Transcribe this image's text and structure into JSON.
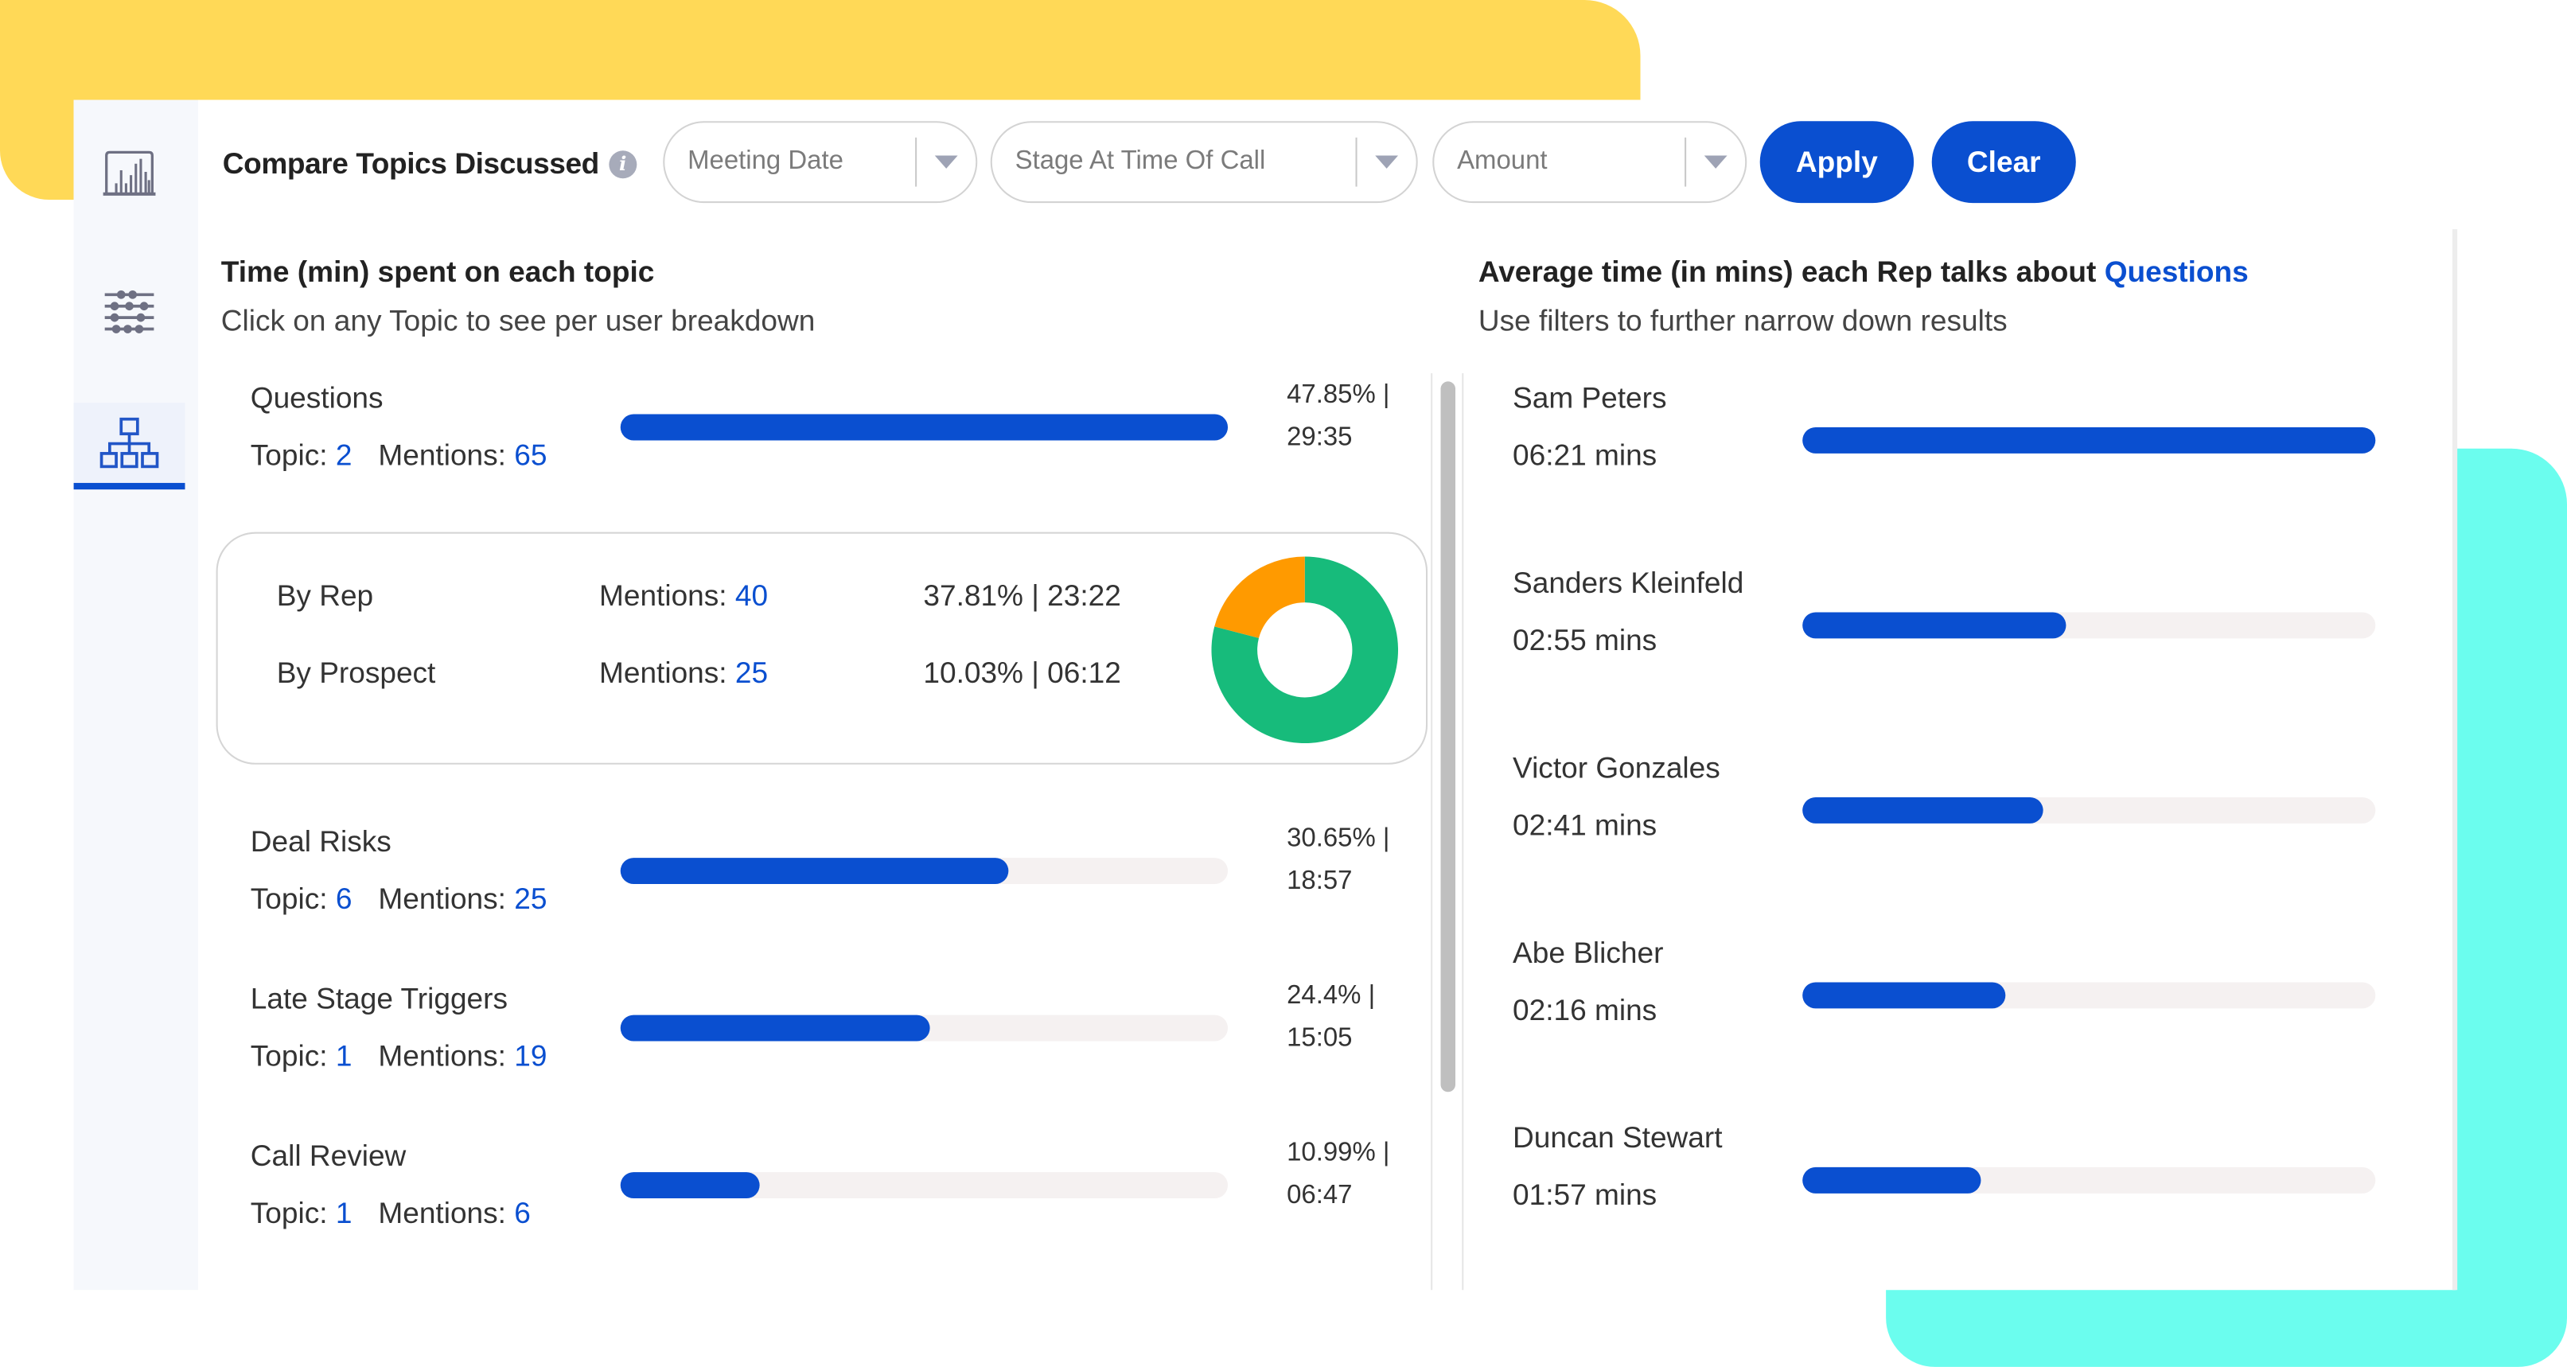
{
  "header": {
    "title": "Compare Topics Discussed",
    "info_icon": "info-icon",
    "filters": [
      {
        "label": "Meeting Date"
      },
      {
        "label": "Stage At Time Of Call"
      },
      {
        "label": "Amount"
      }
    ],
    "apply_label": "Apply",
    "clear_label": "Clear"
  },
  "sidebar": {
    "items": [
      {
        "icon": "bar-chart-icon",
        "active": false
      },
      {
        "icon": "sliders-icon",
        "active": false
      },
      {
        "icon": "hierarchy-icon",
        "active": true
      }
    ]
  },
  "left": {
    "heading": "Time (min) spent on each topic",
    "subheading": "Click on any Topic to see per user breakdown",
    "topic_label": "Topic:",
    "mentions_label": "Mentions:",
    "topics": [
      {
        "name": "Questions",
        "topic": "2",
        "mentions": "65",
        "percent_text": "47.85% |",
        "time": "29:35",
        "progress": 1.0
      },
      {
        "name": "Deal Risks",
        "topic": "6",
        "mentions": "25",
        "percent_text": "30.65% |",
        "time": "18:57",
        "progress": 0.64
      },
      {
        "name": "Late Stage Triggers",
        "topic": "1",
        "mentions": "19",
        "percent_text": "24.4% |",
        "time": "15:05",
        "progress": 0.51
      },
      {
        "name": "Call Review",
        "topic": "1",
        "mentions": "6",
        "percent_text": "10.99% |",
        "time": "06:47",
        "progress": 0.23
      }
    ],
    "breakdown": {
      "rows": [
        {
          "label": "By Rep",
          "mentions_label": "Mentions:",
          "mentions": "40",
          "stat": "37.81% | 23:22"
        },
        {
          "label": "By Prospect",
          "mentions_label": "Mentions:",
          "mentions": "25",
          "stat": "10.03% | 06:12"
        }
      ],
      "donut": [
        {
          "name": "By Rep",
          "value": 37.81,
          "color": "#17BB7B"
        },
        {
          "name": "By Prospect",
          "value": 10.03,
          "color": "#FF9A00"
        }
      ]
    }
  },
  "right": {
    "heading_prefix": "Average time (in mins) each Rep talks about ",
    "heading_topic": "Questions",
    "subheading": "Use filters to further narrow down results",
    "reps": [
      {
        "name": "Sam Peters",
        "time": "06:21 mins",
        "progress": 1.0
      },
      {
        "name": "Sanders Kleinfeld",
        "time": "02:55 mins",
        "progress": 0.46
      },
      {
        "name": "Victor Gonzales",
        "time": "02:41 mins",
        "progress": 0.42
      },
      {
        "name": "Abe Blicher",
        "time": "02:16 mins",
        "progress": 0.355
      },
      {
        "name": "Duncan Stewart",
        "time": "01:57 mins",
        "progress": 0.31
      }
    ]
  },
  "colors": {
    "accent": "#0A4FD0",
    "track": "#F5F1F1",
    "yellow": "#FFD957",
    "teal": "#6BFDEE"
  }
}
